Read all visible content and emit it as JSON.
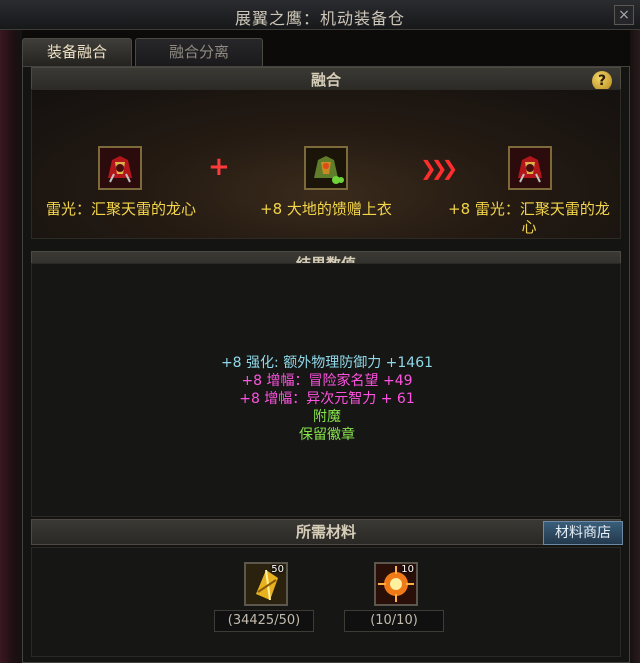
{
  "window": {
    "title": "展翼之鹰：机动装备仓",
    "close_symbol": "×"
  },
  "tabs": [
    {
      "label": "装备融合",
      "active": true
    },
    {
      "label": "融合分离",
      "active": false
    }
  ],
  "fusion": {
    "header": "融合",
    "help_symbol": "?",
    "source_item": {
      "icon": "red-armor-icon",
      "label": "雷光：汇聚天雷的龙心"
    },
    "plus_symbol": "+",
    "material_item": {
      "icon": "green-armor-icon",
      "label": "+8 大地的馈赠上衣"
    },
    "result_item": {
      "icon": "red-armor-icon",
      "label": "+8 雷光：汇聚天雷的龙心"
    }
  },
  "result": {
    "header": "结果数值",
    "lines": [
      {
        "text": "+8 强化: 额外物理防御力 +1461",
        "color": "#8fd8e8"
      },
      {
        "text": "+8 增幅：冒险家名望 +49",
        "color": "#ff52e0"
      },
      {
        "text": "+8 增幅：异次元智力 + 61",
        "color": "#ff52e0"
      },
      {
        "text": "附魔",
        "color": "#86e34a"
      },
      {
        "text": "保留徽章",
        "color": "#86e34a"
      }
    ]
  },
  "materials": {
    "header": "所需材料",
    "shop_button": "材料商店",
    "items": [
      {
        "icon": "gold-crystal-icon",
        "stack": "50",
        "quantity": "(34425/50)"
      },
      {
        "icon": "fire-orb-icon",
        "stack": "10",
        "quantity": "(10/10)"
      }
    ]
  },
  "colors": {
    "item_name": "#f3d54a",
    "accent_red": "#ff3a3a"
  }
}
